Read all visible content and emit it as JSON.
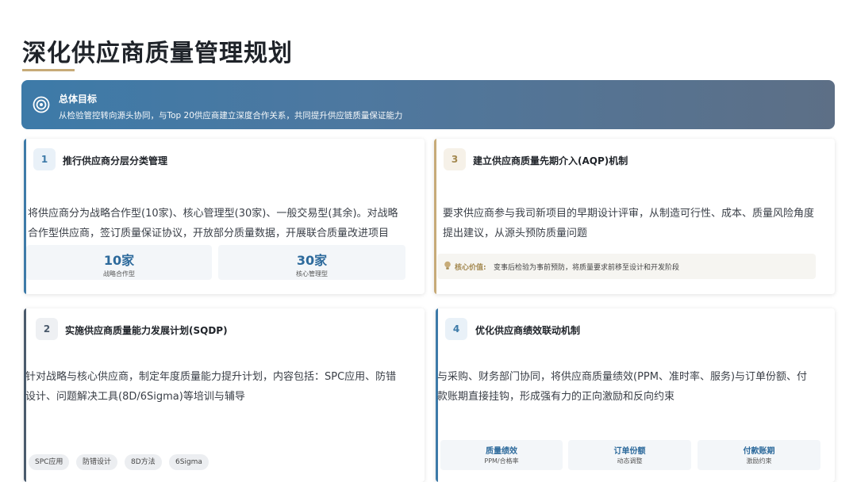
{
  "page": {
    "title": "深化供应商质量管理规划"
  },
  "banner": {
    "title": "总体目标",
    "desc": "从检验管控转向源头协同，与Top 20供应商建立深度合作关系，共同提升供应链质量保证能力",
    "icon": "target-icon"
  },
  "cards": {
    "c1": {
      "num": "1",
      "title": "推行供应商分层分类管理",
      "body_line1": "将供应商分为战略合作型(10家)、核心管理型(30家)、一般交易型(其余)。对战略",
      "body_line2": "合作型供应商，签订质量保证协议，开放部分质量数据，开展联合质量改进项目",
      "stats": [
        {
          "value": "10家",
          "label": "战略合作型"
        },
        {
          "value": "30家",
          "label": "核心管理型"
        }
      ]
    },
    "c2": {
      "num": "2",
      "title": "实施供应商质量能力发展计划(SQDP)",
      "body_line1": "针对战略与核心供应商，制定年度质量能力提升计划，内容包括：SPC应用、防错",
      "body_line2": "设计、问题解决工具(8D/6Sigma)等培训与辅导",
      "tags": [
        "SPC应用",
        "防错设计",
        "8D方法",
        "6Sigma"
      ]
    },
    "c3": {
      "num": "3",
      "title": "建立供应商质量先期介入(AQP)机制",
      "body_line1": "要求供应商参与我司新项目的早期设计评审，从制造可行性、成本、质量风险角度",
      "body_line2": "提出建议，从源头预防质量问题",
      "note_key": "核心价值:",
      "note_text": "变事后检验为事前预防，将质量要求前移至设计和开发阶段"
    },
    "c4": {
      "num": "4",
      "title": "优化供应商绩效联动机制",
      "body_line1": "与采购、财务部门协同，将供应商质量绩效(PPM、准时率、服务)与订单份额、付",
      "body_line2": "款账期直接挂钩，形成强有力的正向激励和反向约束",
      "metrics": [
        {
          "value": "质量绩效",
          "label": "PPM/合格率"
        },
        {
          "value": "订单份额",
          "label": "动态调整"
        },
        {
          "value": "付款账期",
          "label": "激励约束"
        }
      ]
    }
  },
  "colors": {
    "accent_blue": "#3d7aa8",
    "gold": "#c7ab78",
    "bar_dark": "#4a5a6c"
  }
}
